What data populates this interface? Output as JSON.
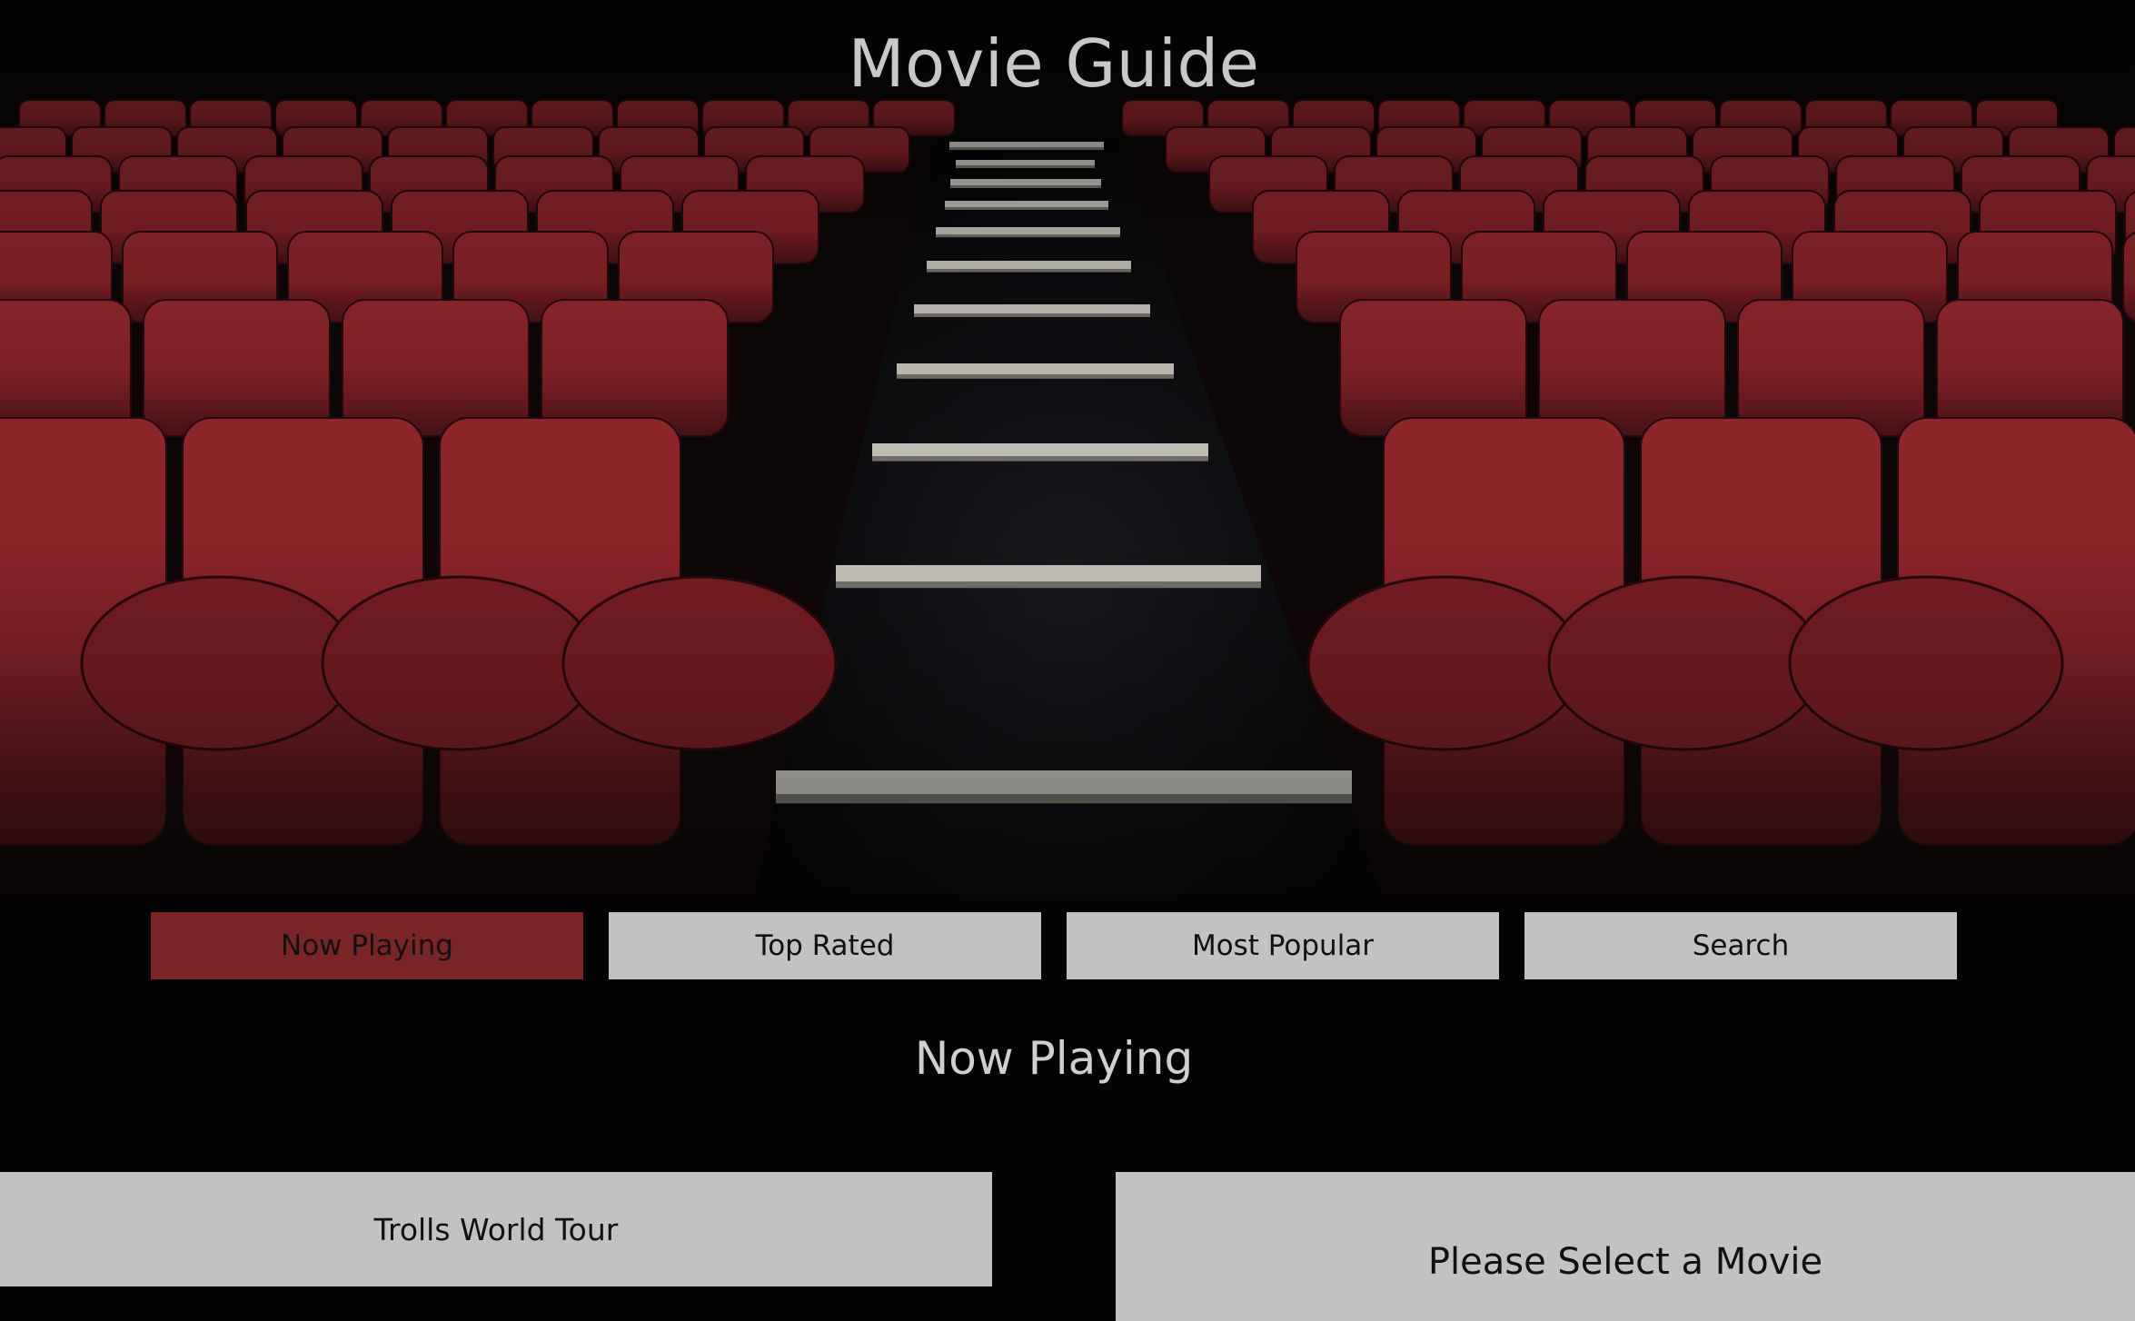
{
  "header": {
    "title": "Movie Guide"
  },
  "nav": {
    "active_index": 0,
    "buttons": [
      "Now Playing",
      "Top Rated",
      "Most Popular",
      "Search"
    ]
  },
  "section": {
    "title": "Now Playing"
  },
  "movies": [
    {
      "title": "Trolls World Tour"
    }
  ],
  "detail": {
    "placeholder": "Please Select a Movie"
  },
  "colors": {
    "background": "#040404",
    "seat_red": "#8a2328",
    "active_button": "#7a2525",
    "button": "#c2c2c2",
    "title_text": "#c8c8c8"
  }
}
